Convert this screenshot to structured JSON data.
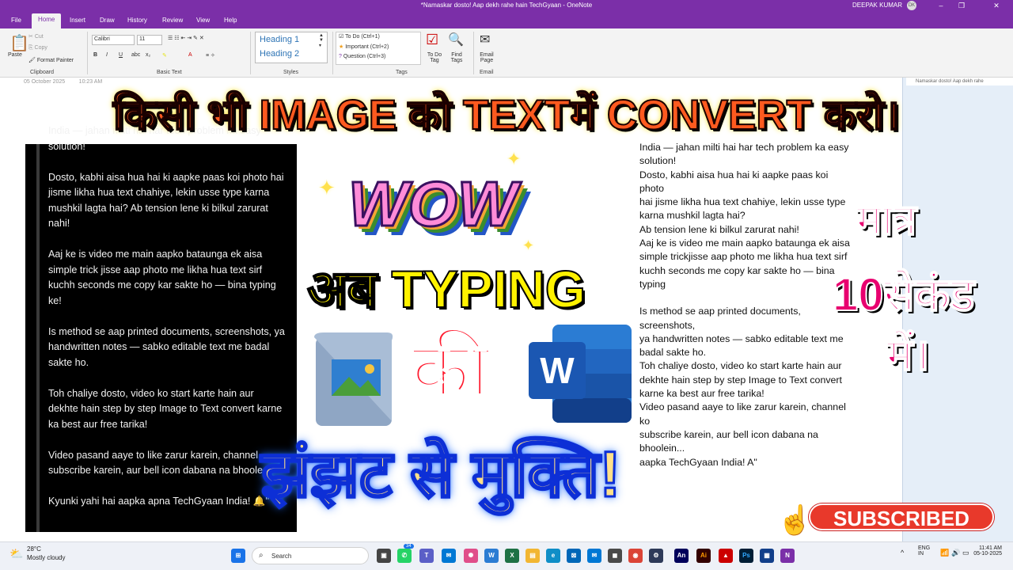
{
  "window": {
    "title": "*Namaskar dosto! Aap dekh rahe hain TechGyaan  -  OneNote",
    "user": "DEEPAK KUMAR",
    "user_initials": "DK"
  },
  "tabs": [
    "File",
    "Home",
    "Insert",
    "Draw",
    "History",
    "Review",
    "View",
    "Help"
  ],
  "ribbon": {
    "clipboard": {
      "paste": "Paste",
      "cut": "Cut",
      "copy": "Copy",
      "format_painter": "Format Painter",
      "label": "Clipboard"
    },
    "basic_text": {
      "font": "Calibri",
      "size": "11",
      "label": "Basic Text"
    },
    "styles": {
      "h1": "Heading 1",
      "h2": "Heading 2",
      "label": "Styles"
    },
    "tags": {
      "todo": "To Do (Ctrl+1)",
      "important": "Important (Ctrl+2)",
      "question": "Question (Ctrl+3)",
      "todo_tag": "To Do Tag",
      "find_tags": "Find Tags",
      "label": "Tags"
    },
    "email": {
      "email_page": "Email Page",
      "label": "Email"
    }
  },
  "page": {
    "date": "05 October 2025",
    "time": "10:23 AM",
    "page_name": "Namaskar dosto! Aap dekh rahe"
  },
  "overlay": {
    "headline": "किसी भी IMAGE को TEXTमें CONVERT करो।",
    "wow": "WOW",
    "typing": "अब TYPING",
    "ki": "की",
    "jhanjhat": "झंझट से मुक्ति!",
    "matra": "मात्र",
    "second": "10सेकंड",
    "mein": "में।",
    "subscribed": "SUBSCRIBED"
  },
  "dark_panel": {
    "paragraphs": [
      "India — jahan milti hai har tech problem ka easy solution!",
      "Dosto, kabhi aisa hua hai ki aapke paas koi photo hai jisme likha hua text chahiye, lekin usse type karna mushkil lagta hai? Ab tension lene ki bilkul zarurat nahi!",
      "Aaj ke is video me main aapko bataunga ek aisa simple trick jisse aap photo me likha hua text sirf kuchh seconds me copy kar sakte ho — bina typing ke!",
      "Is method se aap printed documents, screenshots, ya handwritten notes — sabko editable text me badal sakte ho.",
      "Toh chaliye dosto, video ko start karte hain aur dekhte hain step by step Image to Text convert karne ka best aur free tarika!",
      "Video pasand aaye to like zarur karein, channel subscribe karein, aur bell icon dabana na bhoole",
      "Kyunki yahi hai aapka apna TechGyaan India! 🔔\""
    ]
  },
  "note_text": {
    "lines": [
      "India — jahan milti hai har tech problem ka easy",
      "solution!",
      "Dosto, kabhi aisa hua hai ki aapke paas koi",
      "photo",
      "hai jisme likha hua text chahiye, lekin usse type",
      "karna mushkil lagta hai?",
      "Ab tension lene ki bilkul zarurat nahi!",
      "Aaj ke is video me main aapko bataunga ek aisa",
      "simple trickjisse aap photo me likha hua text sirf",
      "kuchh seconds me copy kar sakte ho — bina",
      "typing",
      "",
      "Is method se aap printed documents,",
      "screenshots,",
      "ya handwritten notes — sabko editable text me",
      "badal sakte ho.",
      "Toh chaliye dosto, video ko start karte hain aur",
      "dekhte hain step by step Image to Text convert",
      "karne ka best aur free tarika!",
      "Video pasand aaye to like zarur karein, channel",
      "ko",
      "subscribe karein, aur bell icon dabana na",
      "bhoolein...",
      "aapka TechGyaan India! A\""
    ]
  },
  "taskbar": {
    "temp": "28°C",
    "weather": "Mostly cloudy",
    "search": "Search",
    "badge": "34",
    "lang": "ENG",
    "lang2": "IN",
    "time": "11:41 AM",
    "date": "05-10-2025"
  }
}
